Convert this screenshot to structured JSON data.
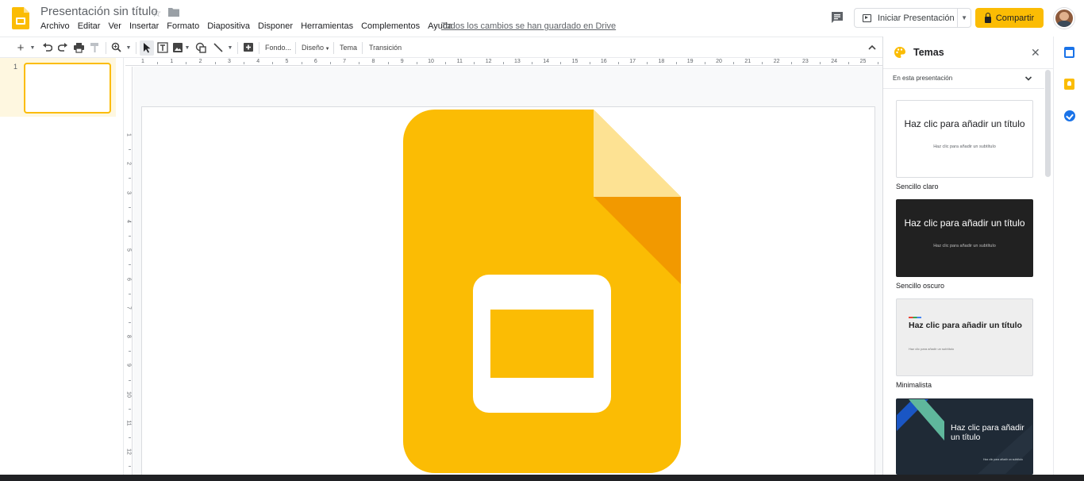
{
  "header": {
    "doc_title": "Presentación sin título",
    "save_status": "Todos los cambios se han guardado en Drive",
    "present_label": "Iniciar Presentación",
    "share_label": "Compartir"
  },
  "menu": [
    "Archivo",
    "Editar",
    "Ver",
    "Insertar",
    "Formato",
    "Diapositiva",
    "Disponer",
    "Herramientas",
    "Complementos",
    "Ayuda"
  ],
  "toolbar": {
    "background_label": "Fondo...",
    "layout_label": "Diseño",
    "theme_label": "Tema",
    "transition_label": "Transición"
  },
  "filmstrip": {
    "slide_number": "1"
  },
  "ruler": {
    "horizontal": [
      "1",
      "1",
      "2",
      "3",
      "4",
      "5",
      "6",
      "7",
      "8",
      "9",
      "10",
      "11",
      "12",
      "13",
      "14",
      "15",
      "16",
      "17",
      "18",
      "19",
      "20",
      "21",
      "22",
      "23",
      "24",
      "25"
    ],
    "vertical": [
      "1",
      "2",
      "3",
      "4",
      "5",
      "6",
      "7",
      "8",
      "9",
      "10",
      "11",
      "12"
    ]
  },
  "themes_panel": {
    "title": "Temas",
    "dropdown_label": "En esta presentación",
    "themes": [
      {
        "name": "Sencillo claro",
        "title": "Haz clic para añadir un título",
        "subtitle": "Haz clic para añadir un subtítulo",
        "bg": "#ffffff",
        "fg": "#202124"
      },
      {
        "name": "Sencillo oscuro",
        "title": "Haz clic para añadir un título",
        "subtitle": "Haz clic para añadir un subtítulo",
        "bg": "#212121",
        "fg": "#ffffff"
      },
      {
        "name": "Minimalista",
        "title": "Haz clic para añadir un título",
        "subtitle": "Haz clic para añadir un subtítulo",
        "bg": "#eeeeee",
        "fg": "#202124"
      },
      {
        "name": "",
        "title": "Haz clic para añadir un título",
        "subtitle": "Haz clic para añadir un subtítulo",
        "bg": "#1f2a36",
        "fg": "#ffffff"
      }
    ]
  },
  "colors": {
    "accent": "#fbbc04",
    "slides_yellow": "#fbbc04",
    "slides_fold_light": "#fde293",
    "slides_fold_dark": "#f29900"
  }
}
